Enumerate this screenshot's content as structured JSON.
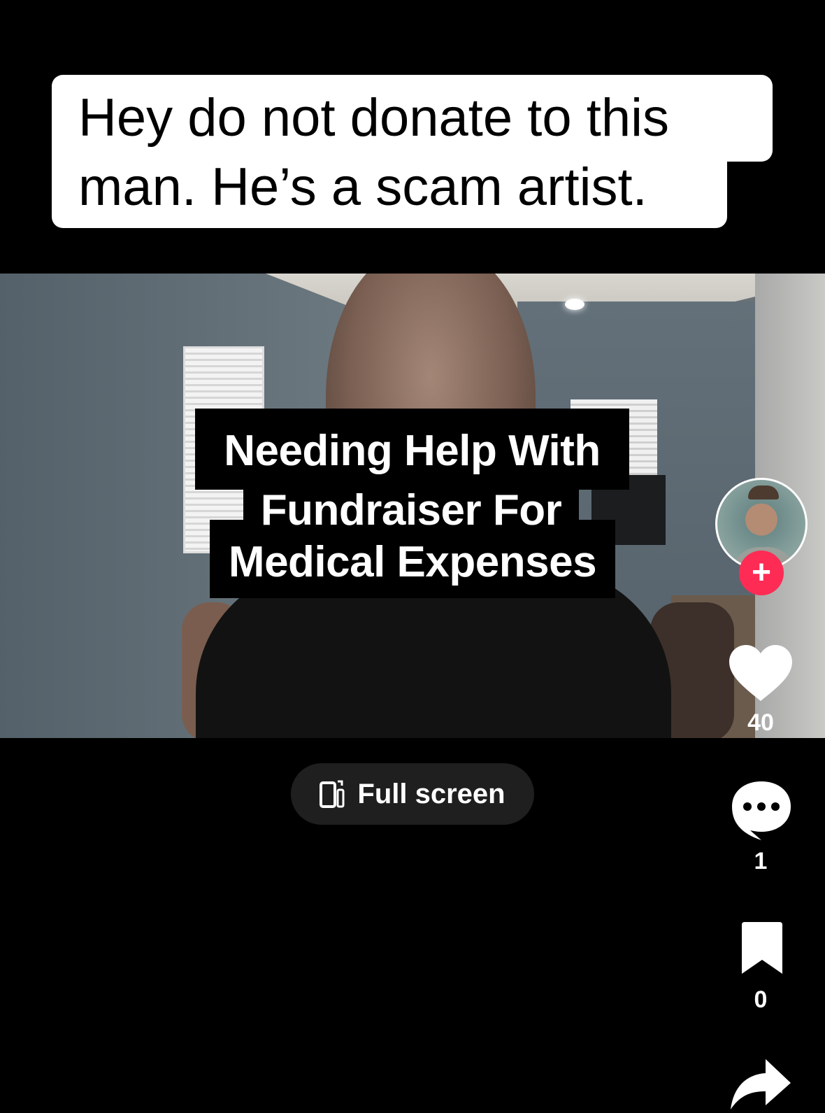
{
  "caption": {
    "line1": "Hey do not donate to this",
    "line2": "man. He’s a scam artist."
  },
  "video_overlay": {
    "line1": "Needing Help With",
    "line2": "Fundraiser For",
    "line3": "Medical Expenses"
  },
  "fullscreen_label": "Full screen",
  "actions": {
    "likes": "40",
    "comments": "1",
    "saves": "0"
  },
  "colors": {
    "follow_accent": "#fe2c55",
    "background": "#000000",
    "button_bg": "#1f1f1f"
  },
  "icons": [
    "expand-screen-icon",
    "plus-icon",
    "heart-icon",
    "comment-icon",
    "bookmark-icon",
    "share-icon"
  ]
}
